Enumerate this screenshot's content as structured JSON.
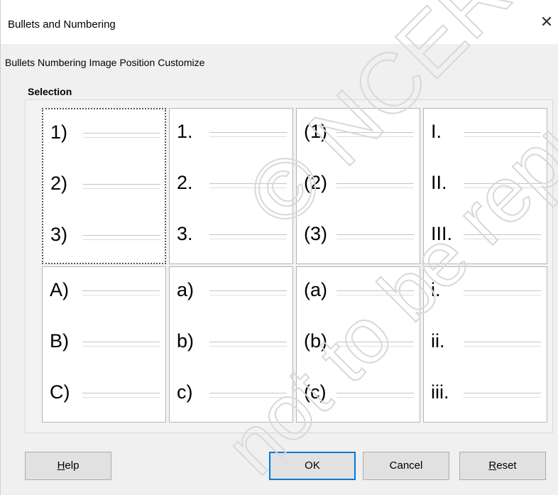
{
  "dialog": {
    "title": "Bullets and Numbering",
    "close_glyph": "✕"
  },
  "tabs": [
    {
      "label": "Bullets"
    },
    {
      "label": "Numbering"
    },
    {
      "label": "Image"
    },
    {
      "label": "Position"
    },
    {
      "label": "Customize"
    }
  ],
  "selection": {
    "label": "Selection",
    "cells": [
      {
        "items": [
          "1)",
          "2)",
          "3)"
        ],
        "selected": true
      },
      {
        "items": [
          "1.",
          "2.",
          "3."
        ]
      },
      {
        "items": [
          "(1)",
          "(2)",
          "(3)"
        ]
      },
      {
        "items": [
          "I.",
          "II.",
          "III."
        ]
      },
      {
        "items": [
          "A)",
          "B)",
          "C)"
        ]
      },
      {
        "items": [
          "a)",
          "b)",
          "c)"
        ]
      },
      {
        "items": [
          "(a)",
          "(b)",
          "(c)"
        ]
      },
      {
        "items": [
          "i.",
          "ii.",
          "iii."
        ]
      }
    ]
  },
  "buttons": {
    "help": "Help",
    "ok": "OK",
    "cancel": "Cancel",
    "reset": "Reset"
  },
  "watermark": {
    "line1": "© NCERT",
    "line2": "not to be republished"
  },
  "colors": {
    "dialog_bg": "#f0f0f0",
    "default_button_border": "#0078d7"
  }
}
